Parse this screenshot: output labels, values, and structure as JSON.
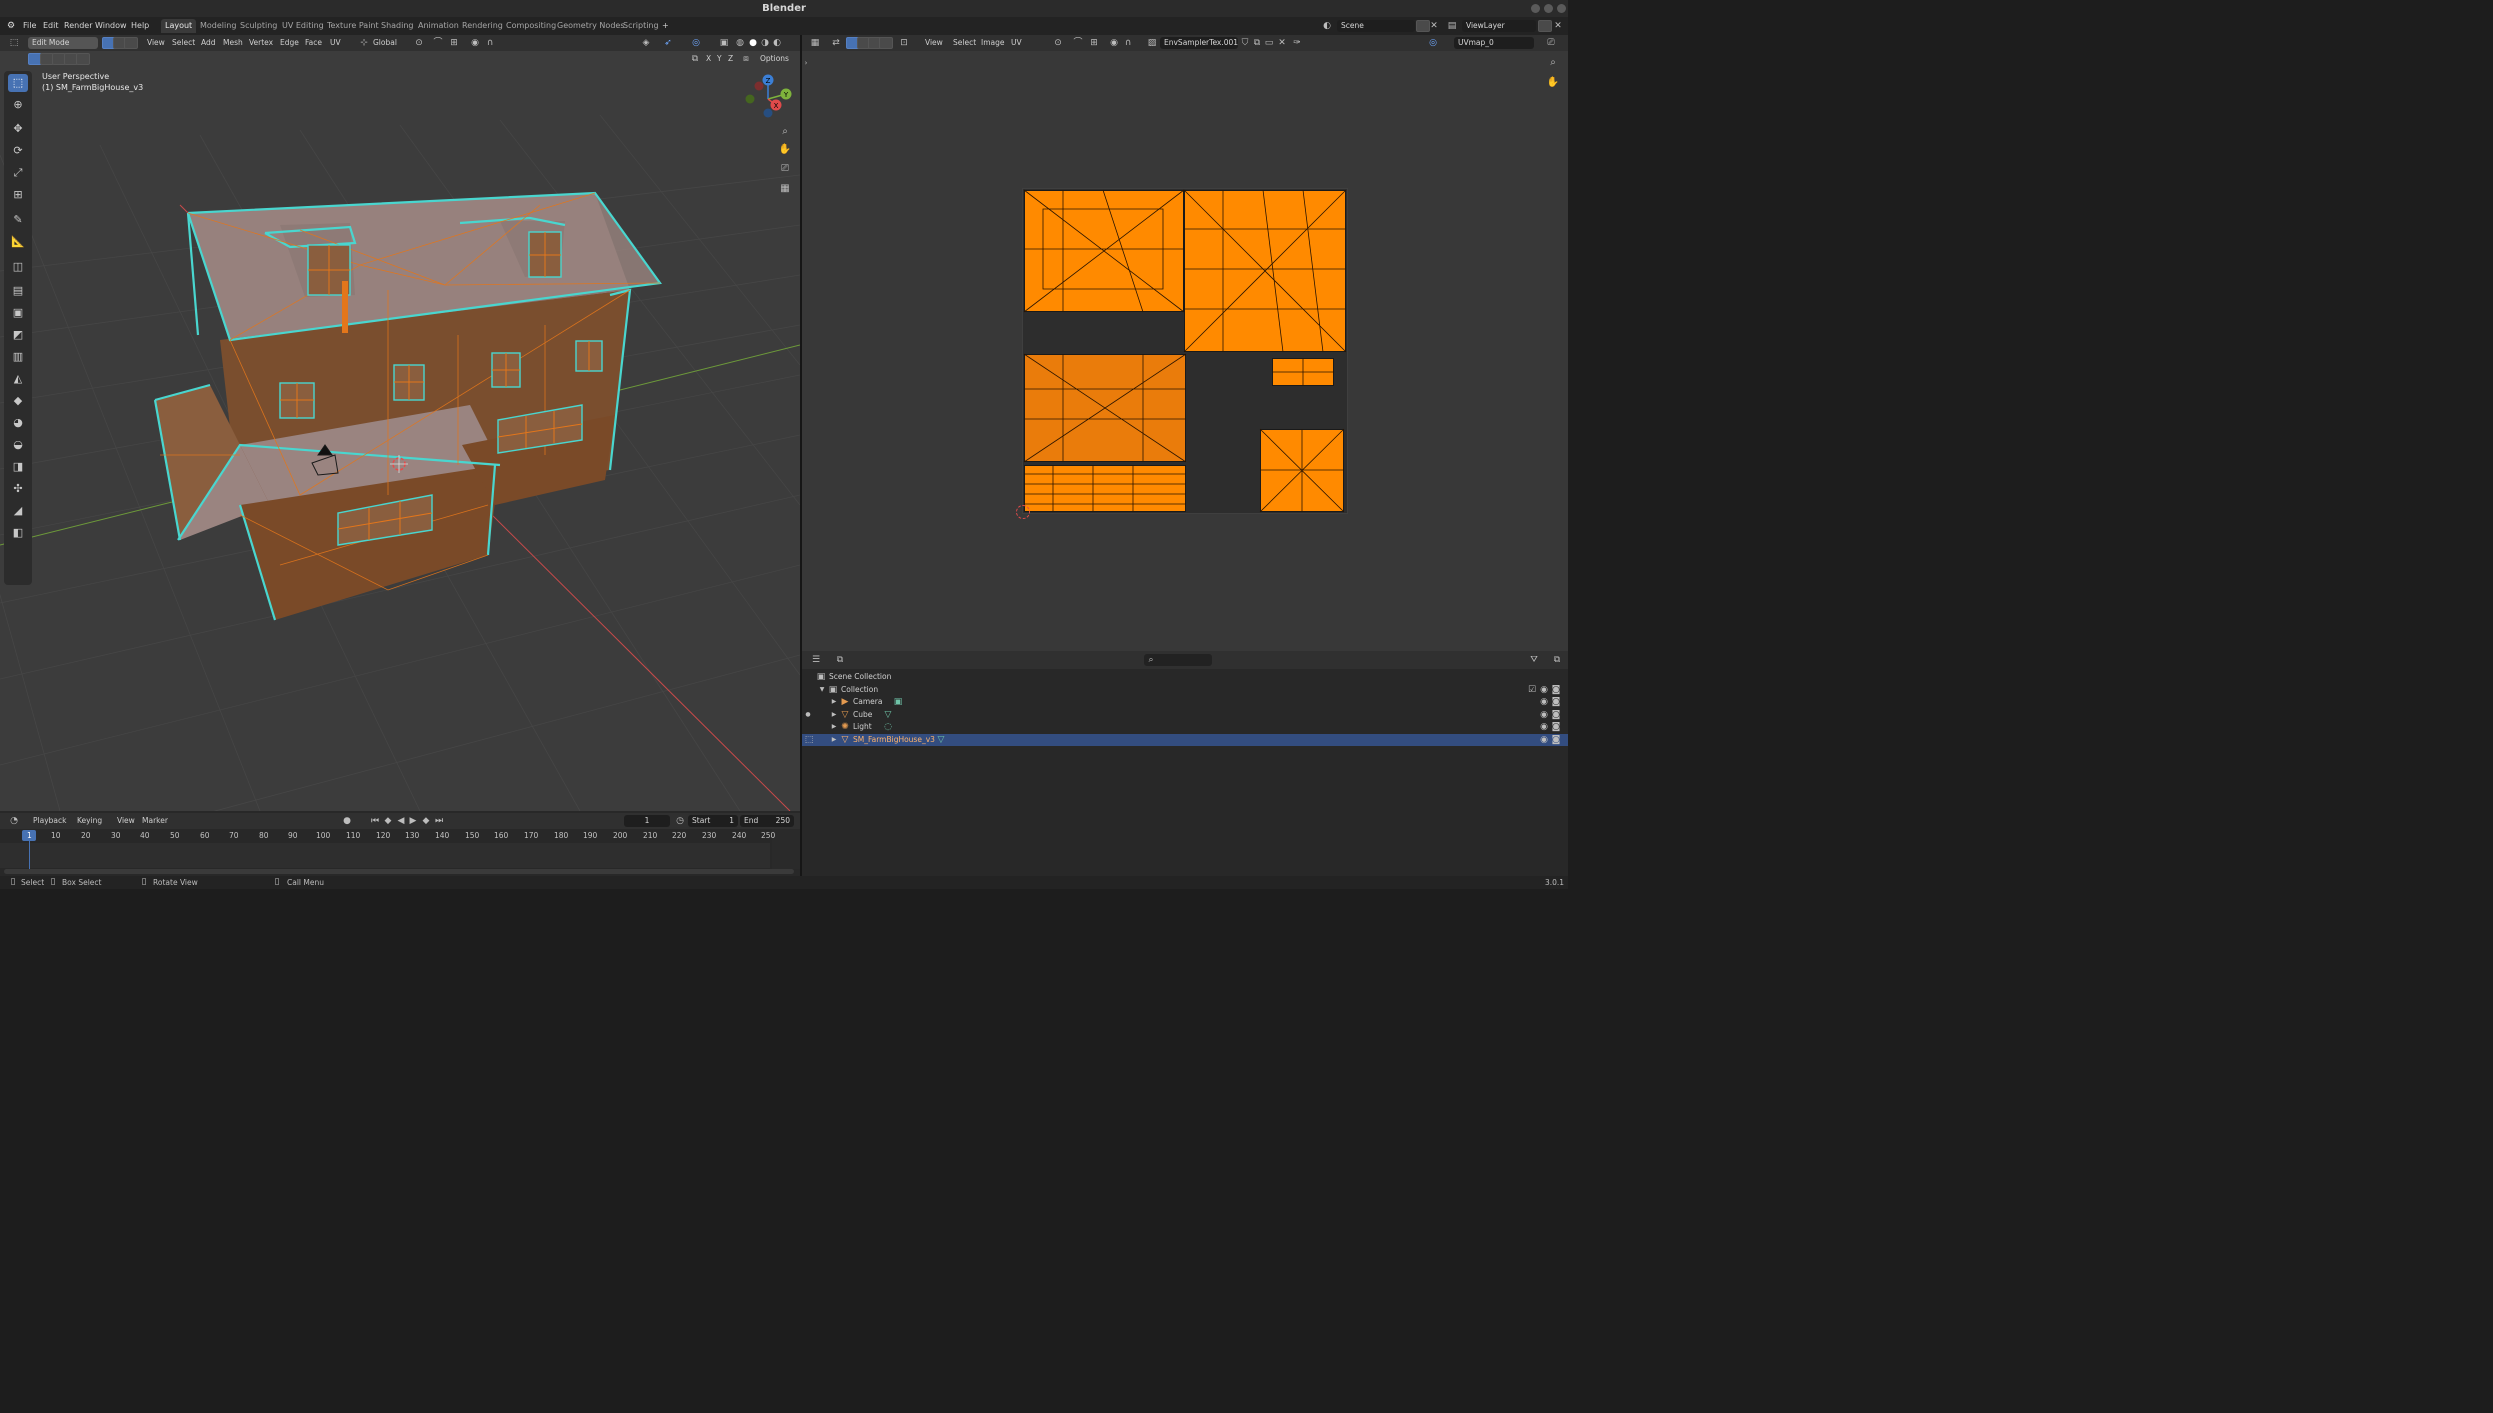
{
  "app": {
    "title": "Blender",
    "version": "3.0.1"
  },
  "menu": [
    "File",
    "Edit",
    "Render",
    "Window",
    "Help"
  ],
  "workspaces": [
    "Layout",
    "Modeling",
    "Sculpting",
    "UV Editing",
    "Texture Paint",
    "Shading",
    "Animation",
    "Rendering",
    "Compositing",
    "Geometry Nodes",
    "Scripting"
  ],
  "active_workspace": "Layout",
  "add_tab_label": "+",
  "scene": {
    "name": "Scene",
    "view_layer": "ViewLayer"
  },
  "viewport": {
    "mode": "Edit Mode",
    "menus": [
      "View",
      "Select",
      "Add",
      "Mesh",
      "Vertex",
      "Edge",
      "Face",
      "UV"
    ],
    "orientation": "Global",
    "perspective_label": "User Perspective",
    "object_label": "(1) SM_FarmBigHouse_v3",
    "options_label": "Options",
    "mirror_axes": [
      "X",
      "Y",
      "Z"
    ],
    "gizmo_axes": [
      "Z",
      "Y",
      "X"
    ],
    "tools": [
      "select-box",
      "cursor",
      "move",
      "rotate",
      "scale",
      "transform",
      "annotate",
      "measure",
      "add-cube",
      "extrude",
      "inset",
      "bevel",
      "loop-cut",
      "knife",
      "poly-build",
      "spin",
      "smooth",
      "shrink-fatten",
      "shear",
      "rip",
      "edge-slide"
    ],
    "active_tool": "select-box"
  },
  "uv_editor": {
    "menus": [
      "View",
      "Select",
      "Image",
      "UV"
    ],
    "image_name": "EnvSamplerTex.001",
    "uv_map": "UVmap_0"
  },
  "outliner": {
    "root": "Scene Collection",
    "collection": "Collection",
    "items": [
      {
        "name": "Camera",
        "icon": "camera-icon",
        "selected": false
      },
      {
        "name": "Cube",
        "icon": "mesh-icon",
        "selected": false
      },
      {
        "name": "Light",
        "icon": "light-icon",
        "selected": false
      },
      {
        "name": "SM_FarmBigHouse_v3",
        "icon": "mesh-icon",
        "selected": true
      }
    ]
  },
  "timeline": {
    "menus": [
      "Playback",
      "Keying",
      "View",
      "Marker"
    ],
    "current_frame": "1",
    "start_label": "Start",
    "start": "1",
    "end_label": "End",
    "end": "250",
    "ticks": [
      "1",
      "10",
      "20",
      "30",
      "40",
      "50",
      "60",
      "70",
      "80",
      "90",
      "100",
      "110",
      "120",
      "130",
      "140",
      "150",
      "160",
      "170",
      "180",
      "190",
      "200",
      "210",
      "220",
      "230",
      "240",
      "250"
    ]
  },
  "statusbar": {
    "select": "Select",
    "box_select": "Box Select",
    "rotate_view": "Rotate View",
    "call_menu": "Call Menu"
  },
  "colors": {
    "accent": "#4772b3",
    "uv_face": "#ff8a00",
    "wire_selected": "#49d6cf",
    "wire_orange": "#e3761b"
  }
}
